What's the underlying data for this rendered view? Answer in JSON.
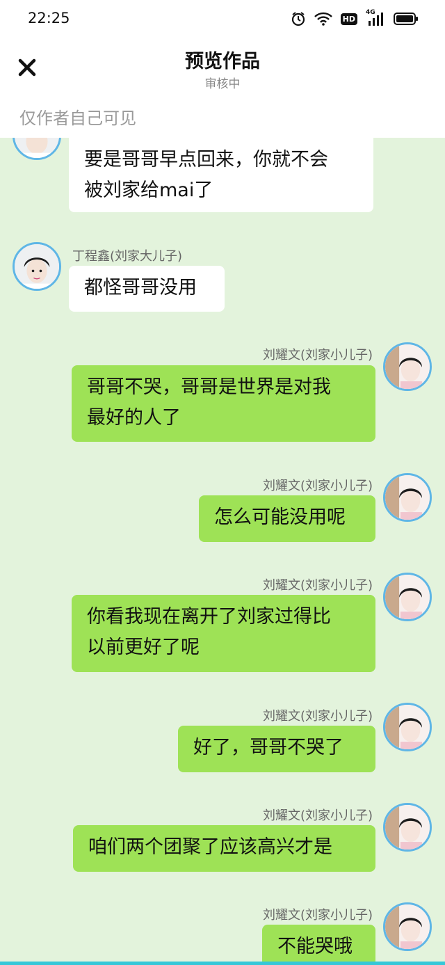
{
  "status": {
    "time": "22:25",
    "icons": [
      "alarm-icon",
      "wifi-icon",
      "hd-icon",
      "4g-signal-icon",
      "battery-icon"
    ],
    "hd_label": "HD",
    "net_label": "4G"
  },
  "header": {
    "title": "预览作品",
    "subtitle": "审核中",
    "visibility_note": "仅作者自己可见"
  },
  "colors": {
    "chat_bg": "#e3f3dc",
    "right_bubble": "#9ee256",
    "left_bubble": "#ffffff",
    "avatar_border": "#5fb6e6"
  },
  "messages": [
    {
      "side": "left",
      "sender": "",
      "text": "要是哥哥早点回来，你就不会\n被刘家给mai了"
    },
    {
      "side": "left",
      "sender": "丁程鑫(刘家大儿子)",
      "text": "都怪哥哥没用"
    },
    {
      "side": "right",
      "sender": "刘耀文(刘家小儿子)",
      "text": "哥哥不哭，哥哥是世界是对我\n最好的人了"
    },
    {
      "side": "right",
      "sender": "刘耀文(刘家小儿子)",
      "text": "怎么可能没用呢"
    },
    {
      "side": "right",
      "sender": "刘耀文(刘家小儿子)",
      "text": "你看我现在离开了刘家过得比\n以前更好了呢"
    },
    {
      "side": "right",
      "sender": "刘耀文(刘家小儿子)",
      "text": "好了，哥哥不哭了"
    },
    {
      "side": "right",
      "sender": "刘耀文(刘家小儿子)",
      "text": "咱们两个团聚了应该高兴才是"
    },
    {
      "side": "right",
      "sender": "刘耀文(刘家小儿子)",
      "text": "不能哭哦"
    }
  ]
}
